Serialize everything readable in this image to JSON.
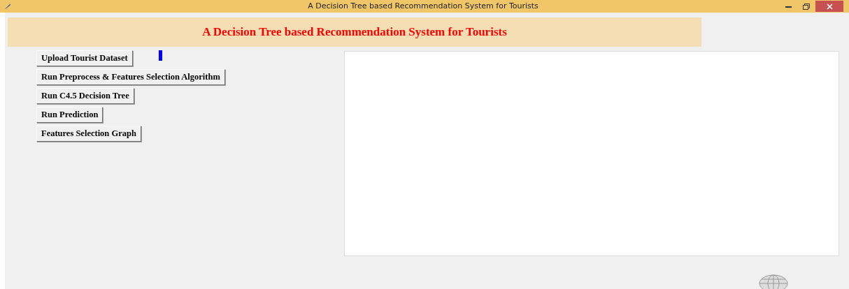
{
  "window": {
    "title": "A Decision Tree based Recommendation System for Tourists"
  },
  "heading": "A Decision Tree based Recommendation System for Tourists",
  "buttons": [
    {
      "label": "Upload Tourist Dataset"
    },
    {
      "label": "Run Preprocess & Features Selection Algorithm"
    },
    {
      "label": "Run C4.5 Decision Tree"
    },
    {
      "label": "Run Prediction"
    },
    {
      "label": "Features Selection Graph"
    }
  ]
}
